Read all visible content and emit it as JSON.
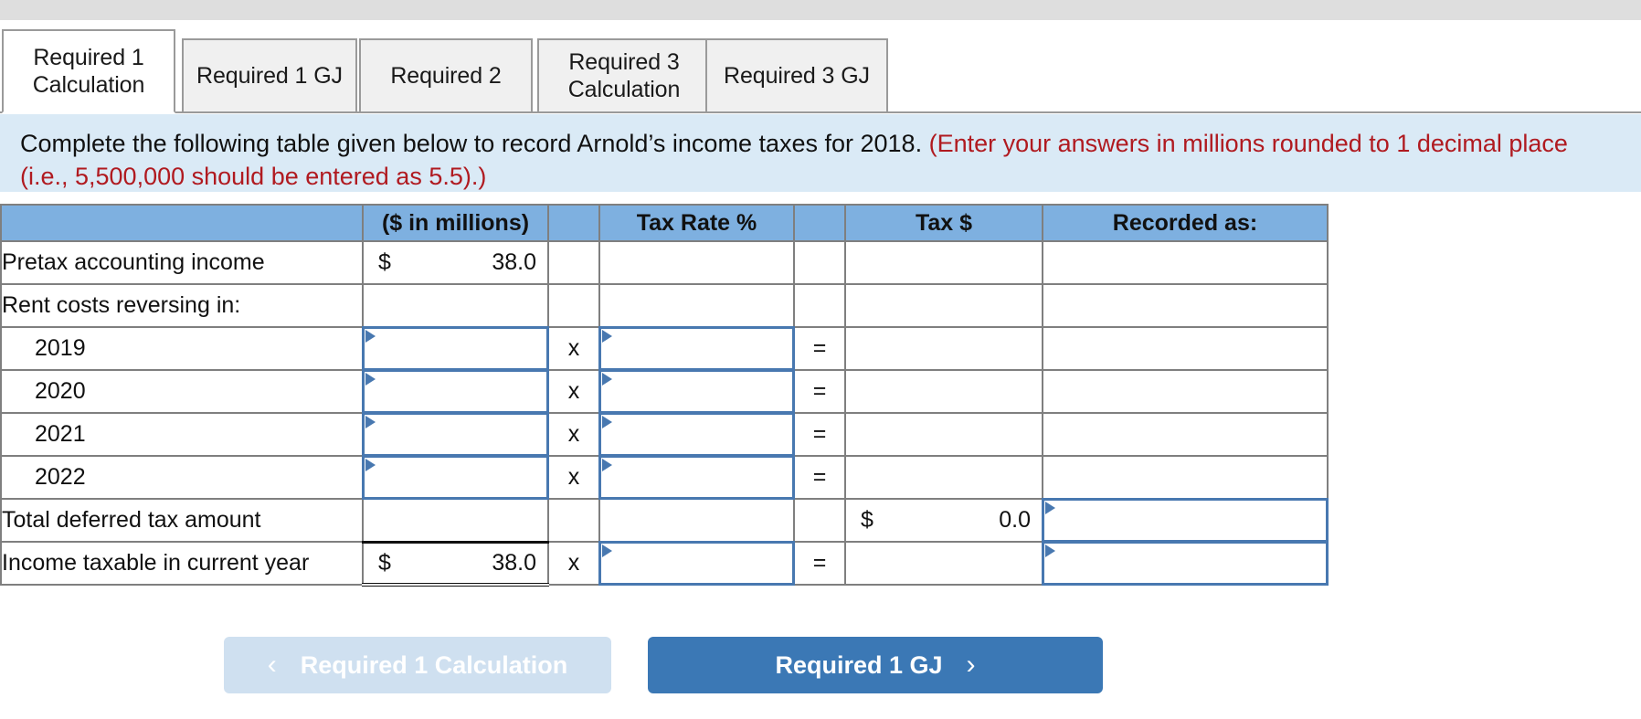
{
  "tabs": [
    {
      "id": "required-1-calculation",
      "label": "Required 1 Calculation",
      "lines": [
        "Required 1",
        "Calculation"
      ],
      "active": true
    },
    {
      "id": "required-1-gj",
      "label": "Required 1 GJ",
      "lines": [
        "Required 1 GJ"
      ],
      "active": false
    },
    {
      "id": "required-2",
      "label": "Required 2",
      "lines": [
        "Required 2"
      ],
      "active": false
    },
    {
      "id": "required-3-calculation",
      "label": "Required 3 Calculation",
      "lines": [
        "Required 3",
        "Calculation"
      ],
      "active": false
    },
    {
      "id": "required-3-gj",
      "label": "Required 3 GJ",
      "lines": [
        "Required 3 GJ"
      ],
      "active": false
    }
  ],
  "instructions": {
    "main": "Complete the following table given below to record Arnold’s income taxes for 2018.",
    "highlight": "(Enter your answers in millions rounded to 1 decimal place (i.e., 5,500,000 should be entered as 5.5).)"
  },
  "table": {
    "headers": {
      "label": "",
      "amount": "($ in millions)",
      "op_times": "",
      "rate": "Tax Rate %",
      "op_equals": "",
      "tax": "Tax $",
      "recorded": "Recorded as:"
    },
    "operators": {
      "times": "x",
      "equals": "="
    },
    "currency_symbol": "$",
    "rows": [
      {
        "id": "pretax-accounting-income",
        "label": "Pretax accounting income",
        "indent": false,
        "amount": {
          "kind": "value",
          "currency": "$",
          "value": "38.0"
        },
        "op_times": "",
        "rate": {
          "kind": "empty",
          "value": ""
        },
        "op_equals": "",
        "tax": {
          "kind": "empty",
          "value": ""
        },
        "recorded": {
          "kind": "empty",
          "value": ""
        }
      },
      {
        "id": "rent-costs-reversing-in",
        "label": "Rent costs reversing in:",
        "indent": false,
        "amount": {
          "kind": "empty",
          "value": ""
        },
        "op_times": "",
        "rate": {
          "kind": "empty",
          "value": ""
        },
        "op_equals": "",
        "tax": {
          "kind": "empty",
          "value": ""
        },
        "recorded": {
          "kind": "empty",
          "value": ""
        }
      },
      {
        "id": "year-2019",
        "label": "2019",
        "indent": true,
        "amount": {
          "kind": "input",
          "value": "",
          "placeholder": ""
        },
        "op_times": "x",
        "rate": {
          "kind": "input",
          "value": "",
          "placeholder": ""
        },
        "op_equals": "=",
        "tax": {
          "kind": "empty",
          "value": ""
        },
        "recorded": {
          "kind": "empty",
          "value": ""
        }
      },
      {
        "id": "year-2020",
        "label": "2020",
        "indent": true,
        "amount": {
          "kind": "input",
          "value": "",
          "placeholder": ""
        },
        "op_times": "x",
        "rate": {
          "kind": "input",
          "value": "",
          "placeholder": ""
        },
        "op_equals": "=",
        "tax": {
          "kind": "empty",
          "value": ""
        },
        "recorded": {
          "kind": "empty",
          "value": ""
        }
      },
      {
        "id": "year-2021",
        "label": "2021",
        "indent": true,
        "amount": {
          "kind": "input",
          "value": "",
          "placeholder": ""
        },
        "op_times": "x",
        "rate": {
          "kind": "input",
          "value": "",
          "placeholder": ""
        },
        "op_equals": "=",
        "tax": {
          "kind": "empty",
          "value": ""
        },
        "recorded": {
          "kind": "empty",
          "value": ""
        }
      },
      {
        "id": "year-2022",
        "label": "2022",
        "indent": true,
        "amount": {
          "kind": "input",
          "value": "",
          "placeholder": ""
        },
        "op_times": "x",
        "rate": {
          "kind": "input",
          "value": "",
          "placeholder": ""
        },
        "op_equals": "=",
        "tax": {
          "kind": "empty",
          "value": ""
        },
        "recorded": {
          "kind": "empty",
          "value": ""
        }
      },
      {
        "id": "total-deferred-tax-amount",
        "label": "Total deferred tax amount",
        "indent": false,
        "amount": {
          "kind": "empty",
          "value": ""
        },
        "op_times": "",
        "rate": {
          "kind": "empty",
          "value": ""
        },
        "op_equals": "",
        "tax": {
          "kind": "value",
          "currency": "$",
          "value": "0.0"
        },
        "recorded": {
          "kind": "input",
          "value": "",
          "placeholder": ""
        }
      },
      {
        "id": "income-taxable-in-current-year",
        "label": "Income taxable in current year",
        "indent": false,
        "amount": {
          "kind": "value",
          "currency": "$",
          "value": "38.0",
          "ruled": true
        },
        "op_times": "x",
        "rate": {
          "kind": "input",
          "value": "",
          "placeholder": ""
        },
        "op_equals": "=",
        "tax": {
          "kind": "empty",
          "value": ""
        },
        "recorded": {
          "kind": "input",
          "value": "",
          "placeholder": ""
        }
      }
    ]
  },
  "nav": {
    "prev": {
      "label": "Required 1 Calculation",
      "chevron": "‹",
      "disabled": true
    },
    "next": {
      "label": "Required 1 GJ",
      "chevron": "›",
      "disabled": false
    }
  },
  "colors": {
    "header_blue": "#7eb0e0",
    "banner_blue": "#daeaf6",
    "accent_red": "#b01a20",
    "input_border": "#4878b0",
    "primary_button": "#3b78b5",
    "disabled_button": "#cfe0f0",
    "topbar_gray": "#dedede"
  }
}
